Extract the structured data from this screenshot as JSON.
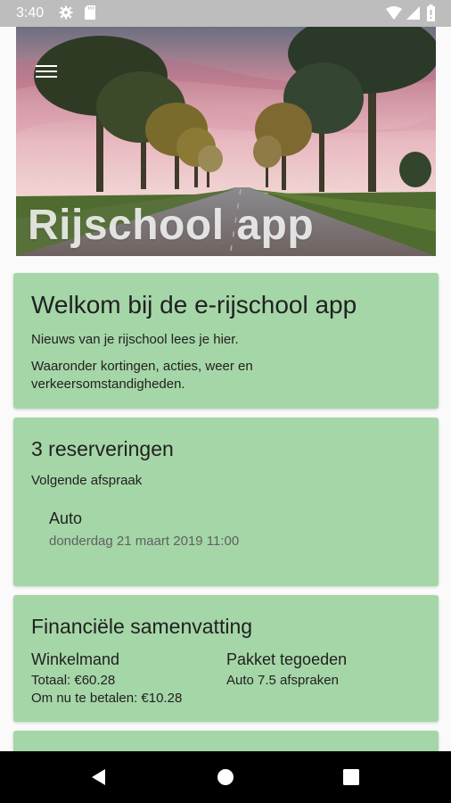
{
  "status_bar": {
    "time": "3:40",
    "icons": [
      "gear-icon",
      "sd-card-icon",
      "wifi-icon",
      "signal-icon",
      "battery-icon"
    ]
  },
  "header": {
    "title": "Rijschool app",
    "menu_icon": "hamburger-menu-icon",
    "image": "tree-lined-road-sunset"
  },
  "welcome_card": {
    "title": "Welkom bij de e-rijschool app",
    "line1": "Nieuws van je rijschool lees je hier.",
    "line2": "Waaronder kortingen, acties, weer en verkeersomstandigheden."
  },
  "reservations_card": {
    "title": "3 reserveringen",
    "subtitle": "Volgende afspraak",
    "next_type": "Auto",
    "next_datetime": "donderdag 21 maart 2019 11:00"
  },
  "finance_card": {
    "title": "Financiële samenvatting",
    "cart_heading": "Winkelmand",
    "cart_total": "Totaal: €60.28",
    "cart_due": "Om nu te betalen: €10.28",
    "package_heading": "Pakket tegoeden",
    "package_line": "Auto 7.5 afspraken"
  },
  "nav_bar": {
    "icons": [
      "back-icon",
      "home-icon",
      "recent-apps-icon"
    ]
  },
  "colors": {
    "card_bg": "#a5d6a7",
    "status_bar": "#bdbdbd",
    "nav_bar": "#000000"
  }
}
